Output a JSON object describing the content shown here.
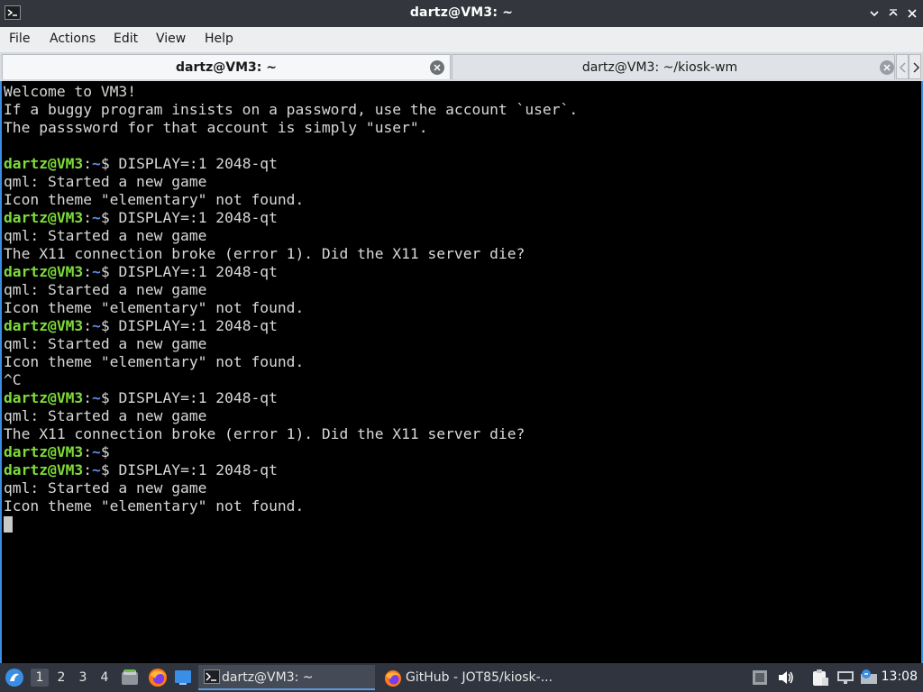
{
  "window": {
    "title": "dartz@VM3: ~"
  },
  "menu": [
    "File",
    "Actions",
    "Edit",
    "View",
    "Help"
  ],
  "tabs": [
    {
      "label": "dartz@VM3: ~",
      "active": true
    },
    {
      "label": "dartz@VM3: ~/kiosk-wm",
      "active": false
    }
  ],
  "prompt": {
    "user": "dartz@VM3",
    "path": "~",
    "symbol": "$"
  },
  "terminal": {
    "lines": [
      {
        "type": "text",
        "text": "Welcome to VM3!"
      },
      {
        "type": "text",
        "text": "If a buggy program insists on a password, use the account `user`."
      },
      {
        "type": "text",
        "text": "The passsword for that account is simply \"user\"."
      },
      {
        "type": "text",
        "text": ""
      },
      {
        "type": "prompt",
        "cmd": " DISPLAY=:1 2048-qt"
      },
      {
        "type": "text",
        "text": "qml: Started a new game"
      },
      {
        "type": "text",
        "text": "Icon theme \"elementary\" not found."
      },
      {
        "type": "prompt",
        "cmd": " DISPLAY=:1 2048-qt"
      },
      {
        "type": "text",
        "text": "qml: Started a new game"
      },
      {
        "type": "text",
        "text": "The X11 connection broke (error 1). Did the X11 server die?"
      },
      {
        "type": "prompt",
        "cmd": " DISPLAY=:1 2048-qt"
      },
      {
        "type": "text",
        "text": "qml: Started a new game"
      },
      {
        "type": "text",
        "text": "Icon theme \"elementary\" not found."
      },
      {
        "type": "prompt",
        "cmd": " DISPLAY=:1 2048-qt"
      },
      {
        "type": "text",
        "text": "qml: Started a new game"
      },
      {
        "type": "text",
        "text": "Icon theme \"elementary\" not found."
      },
      {
        "type": "text",
        "text": "^C"
      },
      {
        "type": "prompt",
        "cmd": " DISPLAY=:1 2048-qt"
      },
      {
        "type": "text",
        "text": "qml: Started a new game"
      },
      {
        "type": "text",
        "text": "The X11 connection broke (error 1). Did the X11 server die?"
      },
      {
        "type": "prompt",
        "cmd": ""
      },
      {
        "type": "prompt",
        "cmd": " DISPLAY=:1 2048-qt"
      },
      {
        "type": "text",
        "text": "qml: Started a new game"
      },
      {
        "type": "text",
        "text": "Icon theme \"elementary\" not found."
      },
      {
        "type": "cursor"
      }
    ]
  },
  "taskbar": {
    "workspaces": [
      "1",
      "2",
      "3",
      "4"
    ],
    "active_workspace": "1",
    "tasks": [
      {
        "label": "dartz@VM3: ~",
        "icon": "terminal-icon",
        "active": true
      },
      {
        "label": "GitHub - JOT85/kiosk-...",
        "icon": "firefox-icon",
        "active": false
      }
    ],
    "clock": "13:08"
  },
  "colors": {
    "prompt_user": "#7edc3b",
    "prompt_path": "#5a8de6",
    "terminal_bg": "#000000",
    "accent": "#3a8ee6"
  }
}
